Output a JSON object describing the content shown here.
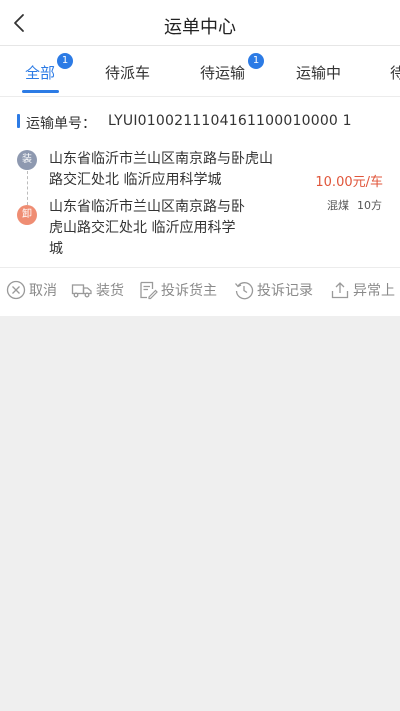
{
  "header": {
    "title": "运单中心",
    "back_icon": "chevron-left-icon"
  },
  "tabs": [
    {
      "label": "全部",
      "badge": "1",
      "active": true
    },
    {
      "label": "待派车"
    },
    {
      "label": "待运输",
      "badge": "1"
    },
    {
      "label": "运输中"
    },
    {
      "label": "待"
    }
  ],
  "order": {
    "number_label": "运输单号：",
    "number": "LYUI0100211104161100010000 1",
    "load_tag": "装",
    "unload_tag": "卸",
    "load_address": "山东省临沂市兰山区南京路与卧虎山路交汇处北 临沂应用科学城",
    "unload_address": "山东省临沂市兰山区南京路与卧虎山路交汇处北 临沂应用科学城",
    "price": "10.00元/车",
    "cargo_type": "混煤",
    "cargo_amount": "10方"
  },
  "actions": [
    {
      "label": "取消",
      "icon": "cancel-icon"
    },
    {
      "label": "装货",
      "icon": "truck-icon"
    },
    {
      "label": "投诉货主",
      "icon": "complaint-icon"
    },
    {
      "label": "投诉记录",
      "icon": "history-icon"
    },
    {
      "label": "异常上",
      "icon": "upload-icon"
    }
  ],
  "colors": {
    "accent": "#2c7be5",
    "price": "#e0563b",
    "load_tag": "#8e99b0",
    "unload_tag": "#ef8d73"
  }
}
